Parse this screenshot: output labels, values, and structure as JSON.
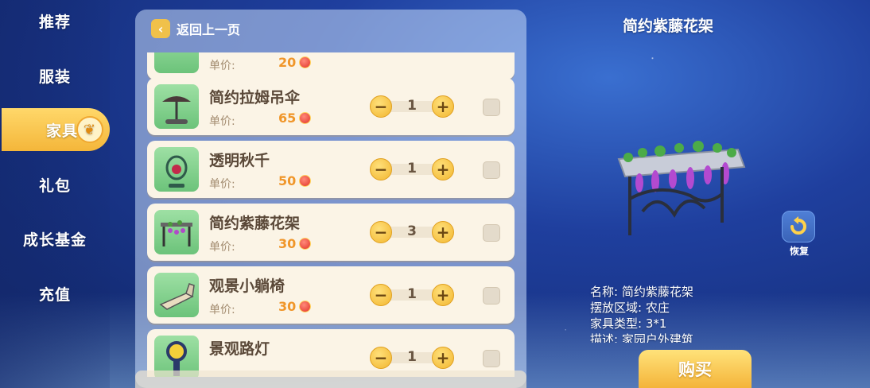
{
  "sidebar": {
    "items": [
      {
        "label": "推荐",
        "active": false
      },
      {
        "label": "服装",
        "active": false
      },
      {
        "label": "家具",
        "active": true
      },
      {
        "label": "礼包",
        "active": false
      },
      {
        "label": "成长基金",
        "active": false
      },
      {
        "label": "充值",
        "active": false
      }
    ]
  },
  "header": {
    "back_label": "返回上一页"
  },
  "price_label": "单价:",
  "items": [
    {
      "name": "",
      "price": "20",
      "qty": ""
    },
    {
      "name": "简约拉姆吊伞",
      "price": "65",
      "qty": "1"
    },
    {
      "name": "透明秋千",
      "price": "50",
      "qty": "1"
    },
    {
      "name": "简约紫藤花架",
      "price": "30",
      "qty": "3"
    },
    {
      "name": "观景小躺椅",
      "price": "30",
      "qty": "1"
    },
    {
      "name": "景观路灯",
      "price": "",
      "qty": "1"
    }
  ],
  "preview": {
    "title": "简约紫藤花架",
    "restore_label": "恢复",
    "info": {
      "name_line": "名称: 简约紫藤花架",
      "area_line": "摆放区域: 农庄",
      "type_line": "家具类型: 3*1",
      "desc_line": "描述: 家园户外建筑"
    },
    "buy_label": "购买"
  },
  "colors": {
    "accent": "#f4b63a",
    "price": "#f0962a",
    "card": "#fbf4e6"
  }
}
